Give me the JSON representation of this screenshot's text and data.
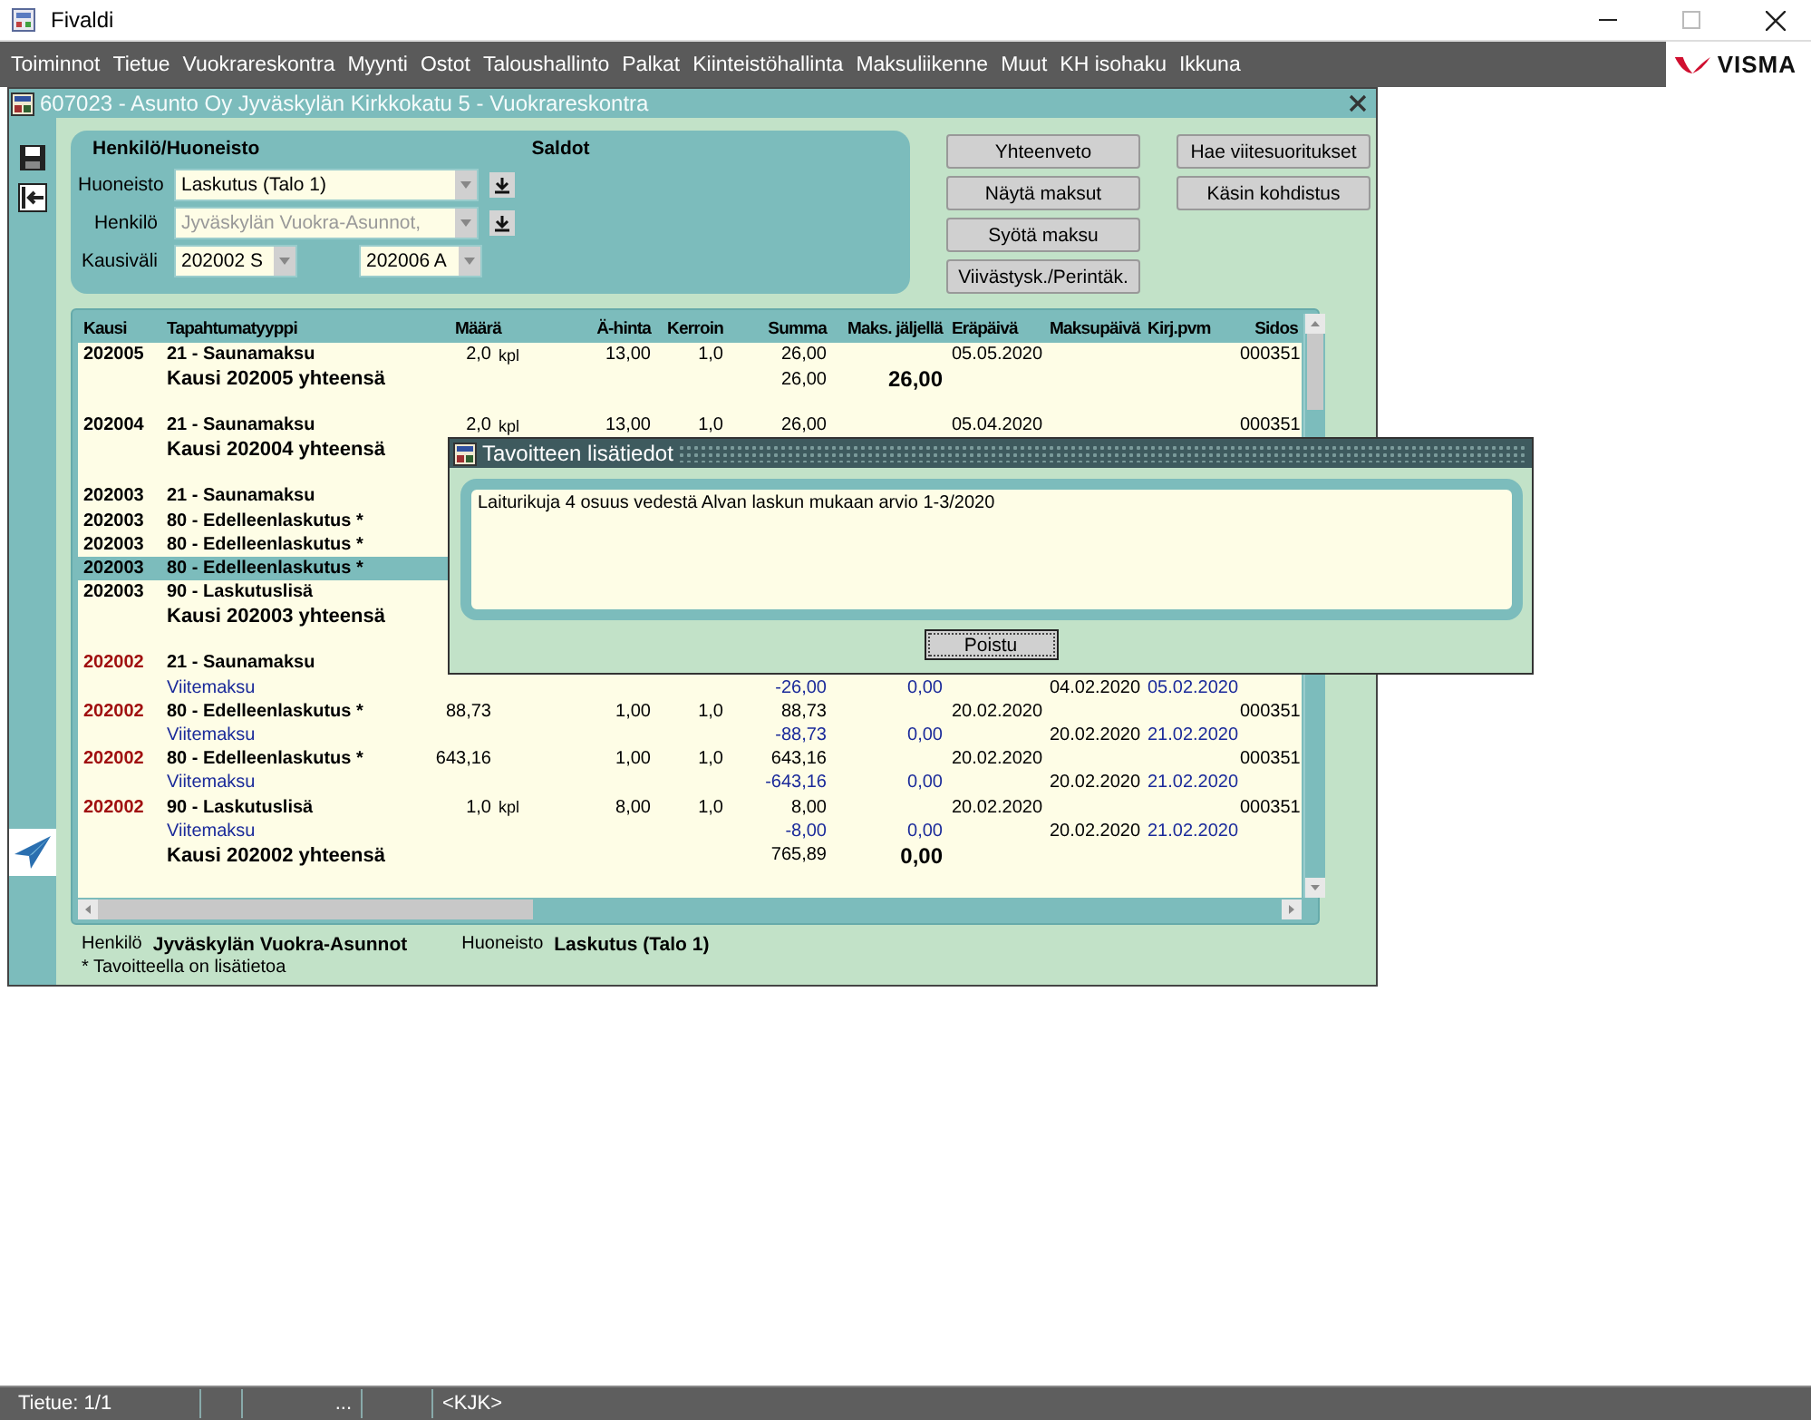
{
  "app": {
    "title": "Fivaldi"
  },
  "menu": [
    "Toiminnot",
    "Tietue",
    "Vuokrareskontra",
    "Myynti",
    "Ostot",
    "Taloushallinto",
    "Palkat",
    "Kiinteistöhallinta",
    "Maksuliikenne",
    "Muut",
    "KH isohaku",
    "Ikkuna"
  ],
  "logo_text": "VISMA",
  "window": {
    "title": "607023 - Asunto Oy Jyväskylän Kirkkokatu 5 - Vuokrareskontra"
  },
  "form": {
    "heading": "Henkilö/Huoneisto",
    "saldot": "Saldot",
    "fields": [
      {
        "label": "Huoneisto",
        "value": "Laskutus (Talo 1)",
        "disabled": false
      },
      {
        "label": "Henkilö",
        "value": "Jyväskylän Vuokra-Asunnot,",
        "disabled": true
      }
    ],
    "period": {
      "label": "Kausiväli",
      "from": "202002 S",
      "to": "202006 A"
    }
  },
  "buttons": [
    [
      "Yhteenveto",
      "Näytä maksut",
      "Syötä maksu",
      "Viivästysk./Perintäk."
    ],
    [
      "Hae viitesuoritukset",
      "Käsin kohdistus"
    ]
  ],
  "table": {
    "columns": [
      "Kausi",
      "Tapahtumatyyppi",
      "Määrä",
      "Ä-hinta",
      "Kerroin",
      "Summa",
      "Maks. jäljellä",
      "Eräpäivä",
      "Maksupäivä",
      "Kirj.pvm",
      "Sidos"
    ],
    "groups": [
      {
        "rows": [
          {
            "kind": "item",
            "kausi": "202005",
            "type": "21 - Saunamaksu",
            "maara": "2,0",
            "unit": "kpl",
            "ahinta": "13,00",
            "kerroin": "1,0",
            "summa": "26,00",
            "erapaiva": "05.05.2020",
            "sidos": "000351",
            "selected": false,
            "color": "#000000"
          },
          {
            "kind": "total",
            "label": "Kausi 202005 yhteensä",
            "summa": "26,00",
            "jaljella": "26,00"
          }
        ]
      },
      {
        "rows": [
          {
            "kind": "item",
            "kausi": "202004",
            "type": "21 - Saunamaksu",
            "maara": "2,0",
            "unit": "kpl",
            "ahinta": "13,00",
            "kerroin": "1,0",
            "summa": "26,00",
            "erapaiva": "05.04.2020",
            "sidos": "000351",
            "selected": false,
            "color": "#000000"
          },
          {
            "kind": "total",
            "label": "Kausi 202004 yhteensä"
          }
        ]
      },
      {
        "rows": [
          {
            "kind": "item",
            "kausi": "202003",
            "type": "21 - Saunamaksu",
            "selected": false,
            "color": "#000000"
          },
          {
            "kind": "item",
            "kausi": "202003",
            "type": "80 - Edelleenlaskutus *",
            "selected": false,
            "color": "#000000"
          },
          {
            "kind": "item",
            "kausi": "202003",
            "type": "80 - Edelleenlaskutus *",
            "selected": false,
            "color": "#000000"
          },
          {
            "kind": "item",
            "kausi": "202003",
            "type": "80 - Edelleenlaskutus *",
            "selected": true,
            "color": "#000000"
          },
          {
            "kind": "item",
            "kausi": "202003",
            "type": "90 - Laskutuslisä",
            "selected": false,
            "color": "#000000"
          },
          {
            "kind": "total",
            "label": "Kausi 202003 yhteensä"
          }
        ]
      },
      {
        "rows": [
          {
            "kind": "item",
            "kausi": "202002",
            "type": "21 - Saunamaksu",
            "selected": false,
            "color": "#a01010"
          },
          {
            "kind": "payment",
            "label": "Viitemaksu",
            "summa": "-26,00",
            "jaljella": "0,00",
            "maksupaiva": "04.02.2020",
            "kirjpvm": "05.02.2020"
          },
          {
            "kind": "item",
            "kausi": "202002",
            "type": "80 - Edelleenlaskutus *",
            "maara": "88,73",
            "ahinta": "1,00",
            "kerroin": "1,0",
            "summa": "88,73",
            "erapaiva": "20.02.2020",
            "sidos": "000351",
            "selected": false,
            "color": "#a01010"
          },
          {
            "kind": "payment",
            "label": "Viitemaksu",
            "summa": "-88,73",
            "jaljella": "0,00",
            "maksupaiva": "20.02.2020",
            "kirjpvm": "21.02.2020"
          },
          {
            "kind": "item",
            "kausi": "202002",
            "type": "80 - Edelleenlaskutus *",
            "maara": "643,16",
            "ahinta": "1,00",
            "kerroin": "1,0",
            "summa": "643,16",
            "erapaiva": "20.02.2020",
            "sidos": "000351",
            "selected": false,
            "color": "#a01010"
          },
          {
            "kind": "payment",
            "label": "Viitemaksu",
            "summa": "-643,16",
            "jaljella": "0,00",
            "maksupaiva": "20.02.2020",
            "kirjpvm": "21.02.2020"
          },
          {
            "kind": "item",
            "kausi": "202002",
            "type": "90 - Laskutuslisä",
            "maara": "1,0",
            "unit": "kpl",
            "ahinta": "8,00",
            "kerroin": "1,0",
            "summa": "8,00",
            "erapaiva": "20.02.2020",
            "sidos": "000351",
            "selected": false,
            "color": "#a01010"
          },
          {
            "kind": "payment",
            "label": "Viitemaksu",
            "summa": "-8,00",
            "jaljella": "0,00",
            "maksupaiva": "20.02.2020",
            "kirjpvm": "21.02.2020"
          },
          {
            "kind": "total",
            "label": "Kausi 202002 yhteensä",
            "summa": "765,89",
            "jaljella": "0,00"
          }
        ]
      }
    ]
  },
  "footer": {
    "person_label": "Henkilö",
    "person": "Jyväskylän Vuokra-Asunnot",
    "unit_label": "Huoneisto",
    "unit": "Laskutus (Talo 1)",
    "note": "* Tavoitteella on lisätietoa"
  },
  "dialog": {
    "title": "Tavoitteen lisätiedot",
    "text": "Laiturikuja 4 osuus vedestä Alvan laskun mukaan arvio 1-3/2020",
    "button": "Poistu"
  },
  "status_bar": [
    "Tietue: 1/1",
    "...",
    "<KJK>"
  ]
}
